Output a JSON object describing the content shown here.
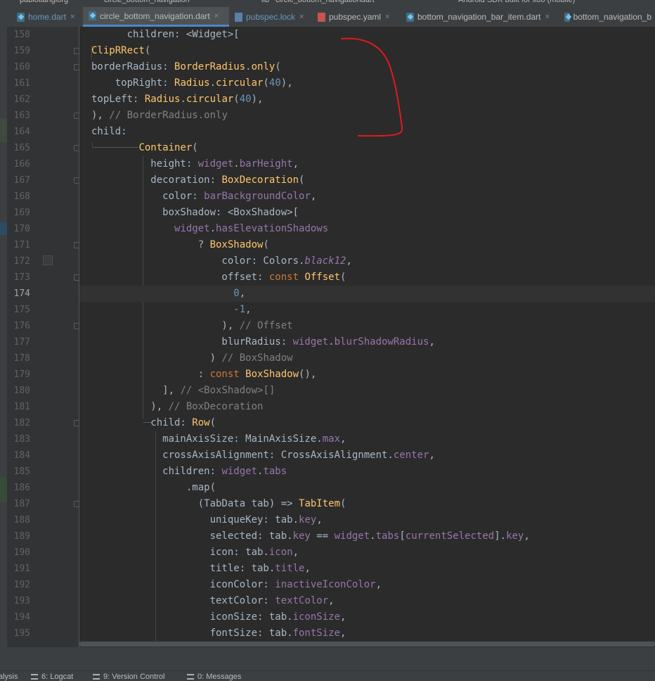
{
  "top_strip": {
    "items": [
      "pablotiangiorg",
      "circle_bottom_navigation",
      "lib",
      "circle_bottom_navigationdart",
      "Android SDK built for x86 (mobile)"
    ]
  },
  "tabs": [
    {
      "label": "home.dart",
      "icon": "dart-file-icon",
      "active": false,
      "closable": true
    },
    {
      "label": "circle_bottom_navigation.dart",
      "icon": "dart-file-icon",
      "active": true,
      "closable": true
    },
    {
      "label": "pubspec.lock",
      "icon": "lock-file-icon",
      "active": false,
      "closable": true
    },
    {
      "label": "pubspec.yaml",
      "icon": "yaml-file-icon",
      "active": false,
      "closable": true
    },
    {
      "label": "bottom_navigation_bar_item.dart",
      "icon": "dart-file-icon",
      "active": false,
      "closable": true
    },
    {
      "label": "bottom_navigation_b",
      "icon": "dart-file-icon",
      "active": false,
      "closable": false
    }
  ],
  "editor": {
    "current_line": 174,
    "lines": [
      {
        "n": 158,
        "tokens": [
          [
            "",
            "      children: <Widget>["
          ]
        ]
      },
      {
        "n": 159,
        "tokens": [
          [
            "fn",
            "ClipRRect"
          ],
          [
            "",
            "("
          ]
        ]
      },
      {
        "n": 160,
        "tokens": [
          [
            "",
            "borderRadius: "
          ],
          [
            "fn",
            "BorderRadius"
          ],
          [
            "",
            "."
          ],
          [
            "fn",
            "only"
          ],
          [
            "",
            "("
          ]
        ]
      },
      {
        "n": 161,
        "tokens": [
          [
            "",
            "    topRight: "
          ],
          [
            "fn",
            "Radius"
          ],
          [
            "",
            "."
          ],
          [
            "fn",
            "circular"
          ],
          [
            "",
            "("
          ],
          [
            "nm",
            "40"
          ],
          [
            "",
            "),"
          ]
        ]
      },
      {
        "n": 162,
        "tokens": [
          [
            "",
            "topLeft: "
          ],
          [
            "fn",
            "Radius"
          ],
          [
            "",
            "."
          ],
          [
            "fn",
            "circular"
          ],
          [
            "",
            "("
          ],
          [
            "nm",
            "40"
          ],
          [
            "",
            "),"
          ]
        ]
      },
      {
        "n": 163,
        "tokens": [
          [
            "",
            "), "
          ],
          [
            "cm",
            "// BorderRadius.only"
          ]
        ]
      },
      {
        "n": 164,
        "tokens": [
          [
            "",
            "child:"
          ]
        ]
      },
      {
        "n": 165,
        "tokens": [
          [
            "",
            "        "
          ],
          [
            "fn",
            "Container"
          ],
          [
            "",
            "("
          ]
        ]
      },
      {
        "n": 166,
        "tokens": [
          [
            "",
            "          height: "
          ],
          [
            "pr",
            "widget"
          ],
          [
            "",
            "."
          ],
          [
            "pr",
            "barHeight"
          ],
          [
            "",
            ","
          ]
        ]
      },
      {
        "n": 167,
        "tokens": [
          [
            "",
            "          decoration: "
          ],
          [
            "fn",
            "BoxDecoration"
          ],
          [
            "",
            "("
          ]
        ]
      },
      {
        "n": 168,
        "tokens": [
          [
            "",
            "            color: "
          ],
          [
            "pr",
            "barBackgroundColor"
          ],
          [
            "",
            ","
          ]
        ]
      },
      {
        "n": 169,
        "tokens": [
          [
            "",
            "            boxShadow: <BoxShadow>["
          ]
        ]
      },
      {
        "n": 170,
        "tokens": [
          [
            "",
            "              "
          ],
          [
            "pr",
            "widget"
          ],
          [
            "",
            "."
          ],
          [
            "pr",
            "hasElevationShadows"
          ]
        ]
      },
      {
        "n": 171,
        "tokens": [
          [
            "",
            "                  ? "
          ],
          [
            "fn",
            "BoxShadow"
          ],
          [
            "",
            "("
          ]
        ]
      },
      {
        "n": 172,
        "tokens": [
          [
            "",
            "                      color: Colors."
          ],
          [
            "pr it",
            "black12"
          ],
          [
            "",
            ","
          ]
        ]
      },
      {
        "n": 173,
        "tokens": [
          [
            "",
            "                      offset: "
          ],
          [
            "kw",
            "const "
          ],
          [
            "fn",
            "Offset"
          ],
          [
            "",
            "("
          ]
        ]
      },
      {
        "n": 174,
        "tokens": [
          [
            "",
            "                        "
          ],
          [
            "nm",
            "0"
          ],
          [
            "",
            ","
          ]
        ]
      },
      {
        "n": 175,
        "tokens": [
          [
            "",
            "                        "
          ],
          [
            "nm",
            "-1"
          ],
          [
            "",
            ","
          ]
        ]
      },
      {
        "n": 176,
        "tokens": [
          [
            "",
            "                      ), "
          ],
          [
            "cm",
            "// Offset"
          ]
        ]
      },
      {
        "n": 177,
        "tokens": [
          [
            "",
            "                      blurRadius: "
          ],
          [
            "pr",
            "widget"
          ],
          [
            "",
            "."
          ],
          [
            "pr",
            "blurShadowRadius"
          ],
          [
            "",
            ","
          ]
        ]
      },
      {
        "n": 178,
        "tokens": [
          [
            "",
            "                    ) "
          ],
          [
            "cm",
            "// BoxShadow"
          ]
        ]
      },
      {
        "n": 179,
        "tokens": [
          [
            "",
            "                  : "
          ],
          [
            "kw",
            "const "
          ],
          [
            "fn",
            "BoxShadow"
          ],
          [
            "",
            "(),"
          ]
        ]
      },
      {
        "n": 180,
        "tokens": [
          [
            "",
            "            ], "
          ],
          [
            "cm",
            "// <BoxShadow>[]"
          ]
        ]
      },
      {
        "n": 181,
        "tokens": [
          [
            "",
            "          ), "
          ],
          [
            "cm",
            "// BoxDecoration"
          ]
        ]
      },
      {
        "n": 182,
        "tokens": [
          [
            "",
            "          child: "
          ],
          [
            "fn",
            "Row"
          ],
          [
            "",
            "("
          ]
        ]
      },
      {
        "n": 183,
        "tokens": [
          [
            "",
            "            mainAxisSize: MainAxisSize."
          ],
          [
            "pr",
            "max"
          ],
          [
            "",
            ","
          ]
        ]
      },
      {
        "n": 184,
        "tokens": [
          [
            "",
            "            crossAxisAlignment: CrossAxisAlignment."
          ],
          [
            "pr",
            "center"
          ],
          [
            "",
            ","
          ]
        ]
      },
      {
        "n": 185,
        "tokens": [
          [
            "",
            "            children: "
          ],
          [
            "pr",
            "widget"
          ],
          [
            "",
            "."
          ],
          [
            "pr",
            "tabs"
          ]
        ]
      },
      {
        "n": 186,
        "tokens": [
          [
            "",
            "                .map("
          ]
        ]
      },
      {
        "n": 187,
        "tokens": [
          [
            "",
            "                  (TabData tab) => "
          ],
          [
            "fn",
            "TabItem"
          ],
          [
            "",
            "("
          ]
        ]
      },
      {
        "n": 188,
        "tokens": [
          [
            "",
            "                    uniqueKey: tab."
          ],
          [
            "pr",
            "key"
          ],
          [
            "",
            ","
          ]
        ]
      },
      {
        "n": 189,
        "tokens": [
          [
            "",
            "                    selected: tab."
          ],
          [
            "pr",
            "key"
          ],
          [
            "",
            " == "
          ],
          [
            "pr",
            "widget"
          ],
          [
            "",
            "."
          ],
          [
            "pr",
            "tabs"
          ],
          [
            "",
            "["
          ],
          [
            "pr",
            "currentSelected"
          ],
          [
            "",
            "]."
          ],
          [
            "pr",
            "key"
          ],
          [
            "",
            ","
          ]
        ]
      },
      {
        "n": 190,
        "tokens": [
          [
            "",
            "                    icon: tab."
          ],
          [
            "pr",
            "icon"
          ],
          [
            "",
            ","
          ]
        ]
      },
      {
        "n": 191,
        "tokens": [
          [
            "",
            "                    title: tab."
          ],
          [
            "pr",
            "title"
          ],
          [
            "",
            ","
          ]
        ]
      },
      {
        "n": 192,
        "tokens": [
          [
            "",
            "                    iconColor: "
          ],
          [
            "pr",
            "inactiveIconColor"
          ],
          [
            "",
            ","
          ]
        ]
      },
      {
        "n": 193,
        "tokens": [
          [
            "",
            "                    textColor: "
          ],
          [
            "pr",
            "textColor"
          ],
          [
            "",
            ","
          ]
        ]
      },
      {
        "n": 194,
        "tokens": [
          [
            "",
            "                    iconSize: tab."
          ],
          [
            "pr",
            "iconSize"
          ],
          [
            "",
            ","
          ]
        ]
      },
      {
        "n": 195,
        "tokens": [
          [
            "",
            "                    fontSize: tab."
          ],
          [
            "pr",
            "fontSize"
          ],
          [
            "",
            ","
          ]
        ]
      }
    ]
  },
  "bottom_bar": {
    "items": [
      {
        "label": "alysis",
        "icon": "list-icon"
      },
      {
        "label": "6: Logcat",
        "icon": "logcat-icon"
      },
      {
        "label": "9: Version Control",
        "icon": "branch-icon"
      },
      {
        "label": "0: Messages",
        "icon": "messages-icon"
      }
    ]
  },
  "colors": {
    "background": "#2b2b2b",
    "gutter": "#313335",
    "keyword": "#cc7832",
    "function": "#ffc66d",
    "property": "#9876aa",
    "number": "#6897bb",
    "comment": "#808080",
    "scribble": "#e01b1b"
  }
}
